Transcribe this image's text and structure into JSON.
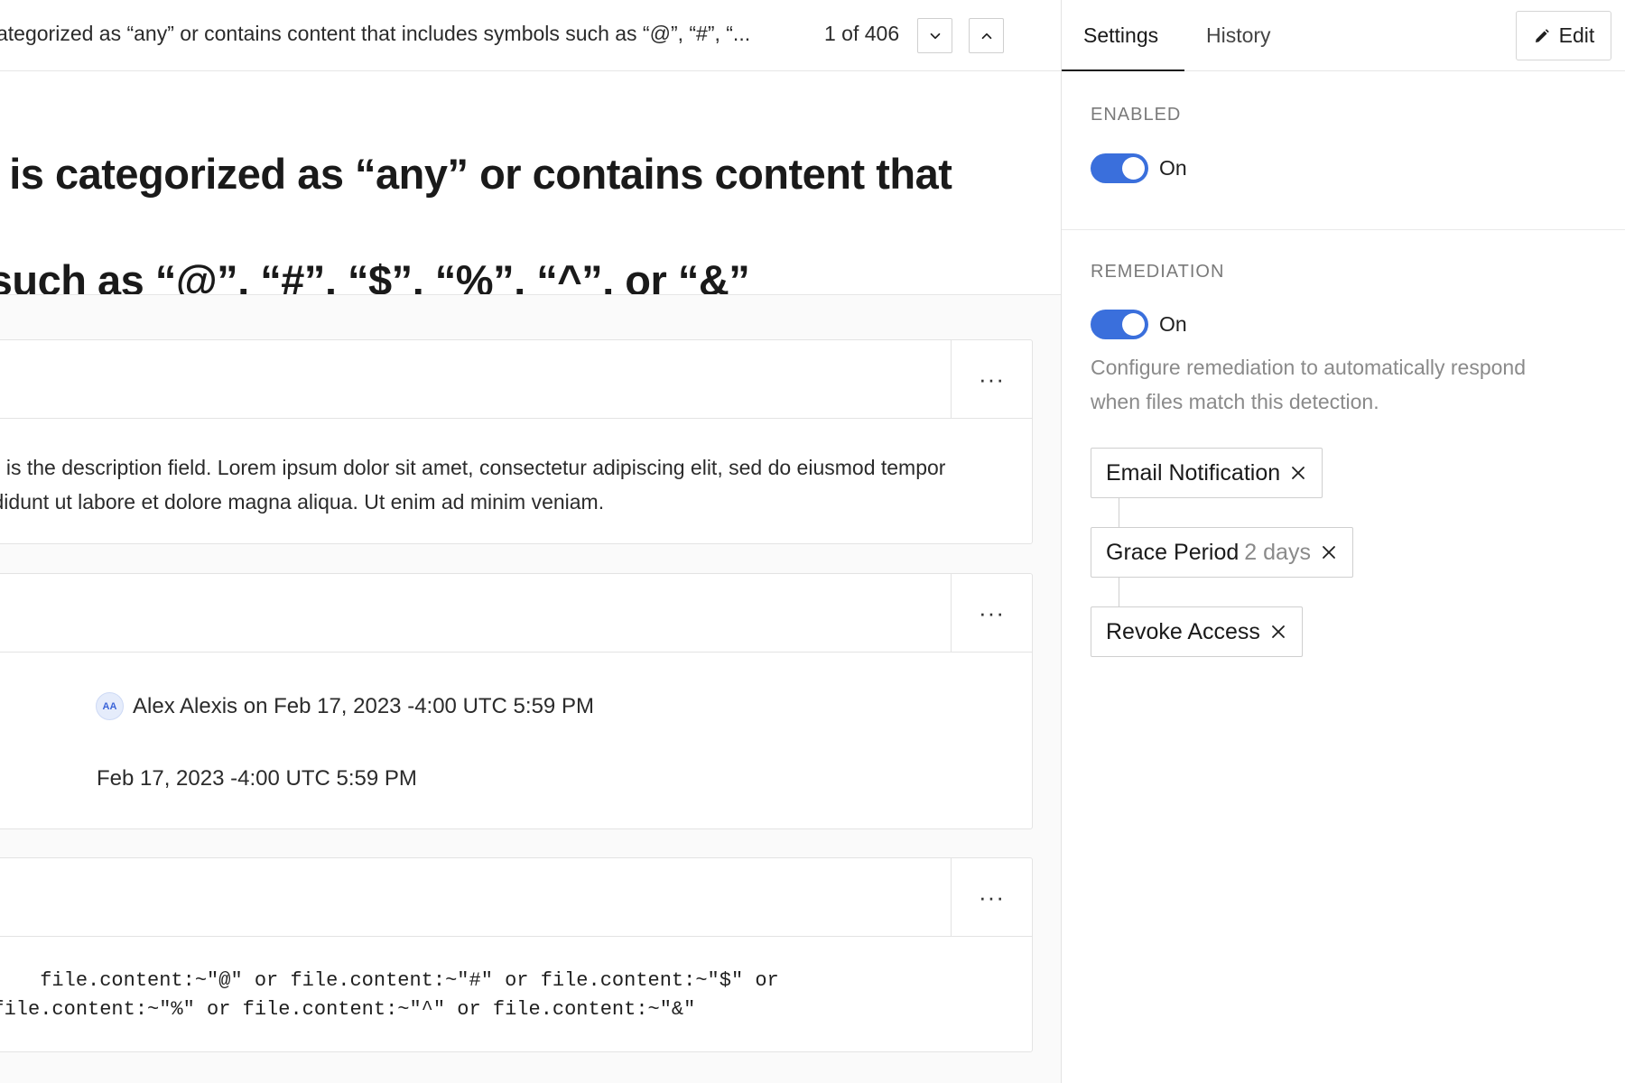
{
  "topbar": {
    "title": "ategorized as “any” or contains content that includes symbols such as “@”, “#”, “...",
    "counter": "1 of 406"
  },
  "page": {
    "title_line1": "Detection is categorized as “any” or contains content that includes",
    "title_line2": "symbols such as “@”, “#”, “$”, “%”, “^”, or “&”"
  },
  "description": {
    "text": "This is the description field. Lorem ipsum dolor sit amet, consectetur adipiscing elit, sed do eiusmod tempor incididunt ut labore et dolore magna aliqua. Ut enim ad minim veniam."
  },
  "activity": {
    "avatar_initials": "AA",
    "author_line": "Alex Alexis on Feb 17, 2023 -4:00 UTC 5:59 PM",
    "date": "Feb 17, 2023 -4:00 UTC 5:59 PM"
  },
  "query": {
    "line1": "      file.content:~\"@\" or file.content:~\"#\" or file.content:~\"$\" or",
    "line2": "  file.content:~\"%\" or file.content:~\"^\" or file.content:~\"&\""
  },
  "card_menu_label": "···",
  "side": {
    "tabs": [
      {
        "label": "Settings",
        "active": true
      },
      {
        "label": "History",
        "active": false
      }
    ],
    "edit_label": "Edit",
    "enabled": {
      "label": "ENABLED",
      "state": "On",
      "on": true
    },
    "remediation": {
      "label": "REMEDIATION",
      "state": "On",
      "on": true,
      "helper": "Configure remediation to automatically respond when files match this detection.",
      "actions": [
        {
          "label": "Email Notification",
          "detail": ""
        },
        {
          "label": "Grace Period",
          "detail": "2 days"
        },
        {
          "label": "Revoke Access",
          "detail": ""
        }
      ]
    }
  },
  "colors": {
    "toggle_on": "#3a6fdc",
    "muted_text": "#8a8a8a"
  },
  "icons": [
    "chevron-down-icon",
    "chevron-up-icon",
    "pencil-icon",
    "more-horizontal-icon",
    "close-icon"
  ]
}
